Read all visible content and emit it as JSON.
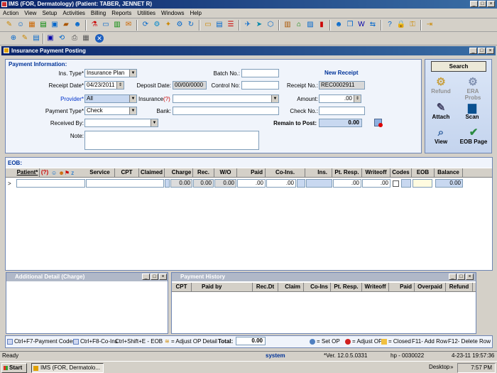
{
  "window": {
    "title": "IMS (FOR, Dermatology)   (Patient: TABER, JENNET R)"
  },
  "menu": [
    "Action",
    "View",
    "Setup",
    "Activities",
    "Billing",
    "Reports",
    "Utilities",
    "Windows",
    "Help"
  ],
  "child": {
    "title": "Insurance Payment Posting"
  },
  "payment_info": {
    "heading": "Payment Information:",
    "ins_type_label": "Ins. Type*",
    "ins_type_value": "Insurance Plan",
    "receipt_date_label": "Receipt Date*",
    "receipt_date_value": "04/23/2011",
    "deposit_date_label": "Deposit Date:",
    "deposit_date_value": "00/00/0000",
    "provider_label": "Provider*",
    "provider_value": "All",
    "insurance_label": "Insurance",
    "insurance_q": "(?)",
    "payment_type_label": "Payment Type*",
    "payment_type_value": "Check",
    "bank_label": "Bank:",
    "received_by_label": "Received By:",
    "note_label": "Note:",
    "batch_label": "Batch No.:",
    "control_label": "Control No:",
    "new_receipt": "New Receipt",
    "receipt_no_label": "Receipt No.:",
    "receipt_no_value": "REC0002911",
    "amount_label": "Amount:",
    "amount_value": ".00",
    "check_no_label": "Check No.:",
    "remain_label": "Remain to Post:",
    "remain_value": "0.00"
  },
  "side": {
    "search": "Search",
    "refund": "Refund",
    "era": "ERA Probs",
    "attach": "Attach",
    "scan": "Scan",
    "view": "View",
    "eob_page": "EOB Page"
  },
  "eob": {
    "heading": "EOB:",
    "columns": [
      "Patient*",
      "(?)",
      "Service",
      "CPT",
      "Claimed",
      "Charge",
      "Rec.",
      "W/O",
      "Paid",
      "Co-Ins.",
      "Ins.",
      "Pt. Resp.",
      "Writeoff",
      "Codes",
      "EOB",
      "Balance"
    ],
    "row": {
      "marker": ">",
      "charge": "0.00",
      "rec": "0.00",
      "wo": "0.00",
      "paid": ".00",
      "coins": ".00",
      "ptresp": ".00",
      "writeoff": ".00",
      "balance": "0.00"
    }
  },
  "additional": {
    "title": "Additional Detail (Charge)"
  },
  "history": {
    "title": "Payment History",
    "columns": [
      "CPT",
      "Paid by",
      "Rec.Dt",
      "Claim",
      "Co-Ins",
      "Pt. Resp.",
      "Writeoff",
      "Paid",
      "Overpaid",
      "Refund"
    ]
  },
  "footer": {
    "left1": "Ctrl+F7-Payment Codes",
    "left2": "Ctrl+F8-Co-Ins",
    "left3": "Ctrl+Shift+E - EOB",
    "adjust_detail": "= Adjust OP Detail",
    "total_label": "Total:",
    "total_value": "0.00",
    "set_op": "= Set OP",
    "adjust_op": "= Adjust OP",
    "closed": "= Closed",
    "f11": "F11- Add Row",
    "f12": "F12- Delete Row"
  },
  "status": {
    "ready": "Ready",
    "system": "system",
    "version": "*Ver. 12.0.5.0331",
    "host": "hp - 0030022",
    "datetime": "4-23-11 19:57:36"
  },
  "taskbar": {
    "start": "Start",
    "task": "IMS (FOR, Dermatolo...",
    "desktop": "Desktop",
    "time": "7:57 PM"
  },
  "colors": {
    "title": "#0a246a",
    "panel": "#f0f4fb",
    "accent": "#003399"
  }
}
